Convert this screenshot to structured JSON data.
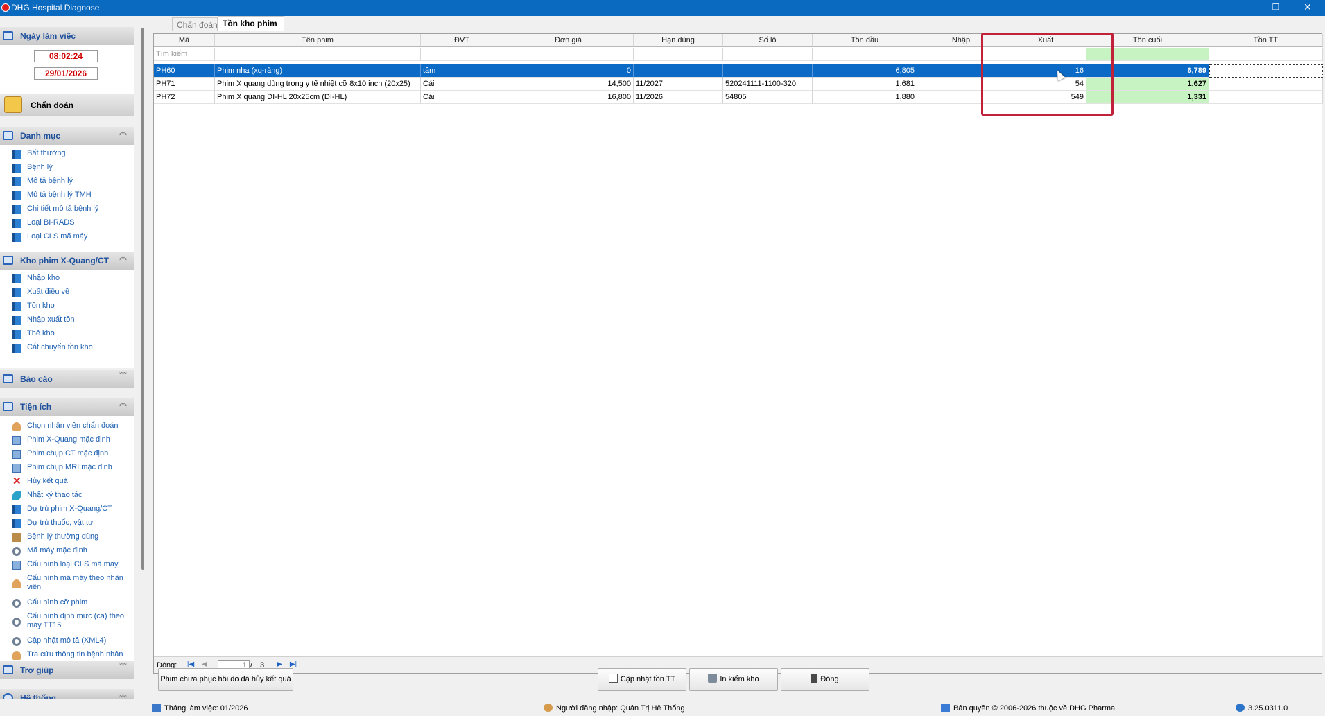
{
  "window": {
    "title": "DHG.Hospital Diagnose",
    "minimize": "—",
    "restore": "❐",
    "close": "✕"
  },
  "sidebar": {
    "work_date_header": "Ngày làm việc",
    "time": "08:02:24",
    "date": "29/01/2026",
    "chandoan_label": "Chẩn đoán",
    "sections": {
      "danhmuc": {
        "title": "Danh mục",
        "items": [
          "Bất thường",
          "Bệnh lý",
          "Mô tả bệnh lý",
          "Mô tả bệnh lý TMH",
          "Chi tiết mô tả bệnh lý",
          "Loại BI-RADS",
          "Loại CLS mã máy"
        ]
      },
      "khophim": {
        "title": "Kho phim X-Quang/CT",
        "items": [
          "Nhập kho",
          "Xuất điều về",
          "Tồn kho",
          "Nhập xuất tồn",
          "Thẻ kho",
          "Cắt chuyển tồn kho"
        ]
      },
      "baocao": {
        "title": "Báo cáo"
      },
      "tienich": {
        "title": "Tiện ích",
        "items": [
          "Chọn nhân viên chẩn đoán",
          "Phim X-Quang mặc định",
          "Phim chụp CT mặc định",
          "Phim chụp MRI mặc định",
          "Hủy kết quả",
          "Nhật ký thao tác",
          "Dự trù phim X-Quang/CT",
          "Dự trù thuốc, vật tư",
          "Bệnh lý thường dùng",
          "Mã máy mặc định",
          "Cấu hình loại CLS mã máy",
          "Cấu hình mã máy theo nhân viên",
          "Cấu hình cỡ phim",
          "Cấu hình định mức (ca) theo máy TT15",
          "Cập nhật mô tả (XML4)",
          "Tra cứu thông tin bệnh nhân"
        ]
      },
      "trogiup": {
        "title": "Trợ giúp"
      },
      "hethong": {
        "title": "Hệ thống"
      }
    }
  },
  "tabs": [
    "Chẩn đoán",
    "Tồn kho phim"
  ],
  "grid": {
    "columns": [
      "Mã",
      "Tên phim",
      "ĐVT",
      "Đơn giá",
      "Hạn dùng",
      "Số lô",
      "Tồn đầu",
      "Nhập",
      "",
      "Xuất",
      "",
      "Tồn cuối",
      "Tồn TT"
    ],
    "filter_placeholder": "Tìm kiếm",
    "rows": [
      {
        "ma": "PH60",
        "ten": "Phim nha (xq-răng)",
        "dvt": "tấm",
        "dongia": "0",
        "handung": "",
        "solo": "",
        "tondau": "6,805",
        "nhap": "",
        "xuat": "16",
        "toncuoi": "6,789",
        "tontt": ""
      },
      {
        "ma": "PH71",
        "ten": "Phim X quang dùng trong y tế nhiệt cỡ 8x10 inch (20x25)",
        "dvt": "Cái",
        "dongia": "14,500",
        "handung": "11/2027",
        "solo": "520241111-1100-320",
        "tondau": "1,681",
        "nhap": "",
        "xuat": "54",
        "toncuoi": "1,627",
        "tontt": ""
      },
      {
        "ma": "PH72",
        "ten": "Phim X quang DI-HL 20x25cm (DI-HL)",
        "dvt": "Cái",
        "dongia": "16,800",
        "handung": "11/2026",
        "solo": "54805",
        "tondau": "1,880",
        "nhap": "",
        "xuat": "549",
        "toncuoi": "1,331",
        "tontt": ""
      }
    ]
  },
  "nav": {
    "label": "Dòng:",
    "page": "1",
    "sep": "/",
    "total": "3"
  },
  "buttons": {
    "restore_cancelled": "Phim chưa phục hồi do đã hủy kết quả",
    "update_tt": "Cập nhật tồn TT",
    "print_check": "In kiểm kho",
    "close": "Đóng"
  },
  "status": {
    "month": "Tháng làm việc: 01/2026",
    "user": "Người đăng nhập: Quản Trị Hệ Thống",
    "copyright": "Bản quyền © 2006-2026 thuộc về DHG Pharma",
    "version": "3.25.0311.0"
  },
  "colors": {
    "titlebar": "#0a6ac0",
    "selection": "#0a6ac6",
    "green_cell": "#c7f3c2",
    "highlight": "#c0223a",
    "time_red": "#d00000"
  }
}
